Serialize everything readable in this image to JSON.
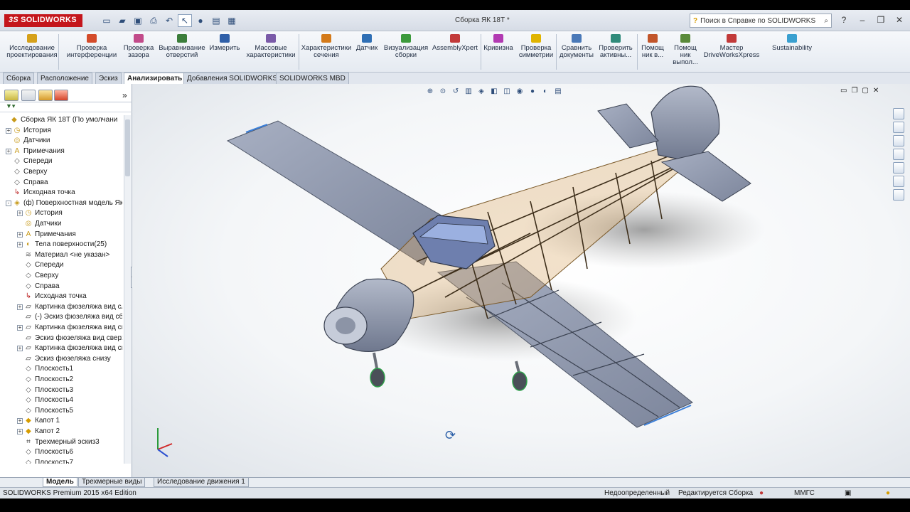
{
  "app": {
    "logo_text": "SOLIDWORKS",
    "logo_prefix": "3S",
    "document_title": "Сборка ЯК 18Т *"
  },
  "help_search": {
    "placeholder": "Поиск в Справке по SOLIDWORKS"
  },
  "ribbon": {
    "items": [
      {
        "label1": "Исследование",
        "label2": "проектирования",
        "icon": "study-icon",
        "color": "#d6a11a"
      },
      {
        "label1": "Проверка",
        "label2": "интерференции",
        "icon": "interference-icon",
        "color": "#d44b2a"
      },
      {
        "label1": "Проверка",
        "label2": "зазора",
        "icon": "clearance-icon",
        "color": "#c24b8a"
      },
      {
        "label1": "Выравнивание",
        "label2": "отверстий",
        "icon": "hole-align-icon",
        "color": "#3b7d3b"
      },
      {
        "label1": "Измерить",
        "label2": "",
        "icon": "measure-icon",
        "color": "#2f5fa8"
      },
      {
        "label1": "Массовые",
        "label2": "характеристики",
        "icon": "mass-props-icon",
        "color": "#7a5aa8"
      },
      {
        "label1": "Характеристики",
        "label2": "сечения",
        "icon": "section-props-icon",
        "color": "#d47a1a"
      },
      {
        "label1": "Датчик",
        "label2": "",
        "icon": "sensor-icon",
        "color": "#2f6fb5"
      },
      {
        "label1": "Визуализация",
        "label2": "сборки",
        "icon": "visualize-icon",
        "color": "#3c9a3c"
      },
      {
        "label1": "AssemblyXpert",
        "label2": "",
        "icon": "assemblyxpert-icon",
        "color": "#c23a3a"
      },
      {
        "label1": "Кривизна",
        "label2": "",
        "icon": "curvature-icon",
        "color": "#b23ab2"
      },
      {
        "label1": "Проверка",
        "label2": "симметрии",
        "icon": "symmetry-icon",
        "color": "#e0b400"
      },
      {
        "label1": "Сравнить",
        "label2": "документы",
        "icon": "compare-icon",
        "color": "#4a79b8"
      },
      {
        "label1": "Проверить",
        "label2": "активны...",
        "icon": "check-active-icon",
        "color": "#2f8a7a"
      },
      {
        "label1": "Помощ",
        "label2": "ник в...",
        "icon": "helper1-icon",
        "color": "#c2552a"
      },
      {
        "label1": "Помощ",
        "label2": "ник",
        "label3": "выпол...",
        "icon": "helper2-icon",
        "color": "#5a8a3a"
      },
      {
        "label1": "Мастер",
        "label2": "DriveWorksXpress",
        "icon": "driveworks-icon",
        "color": "#c23a3a"
      },
      {
        "label1": "Sustainability",
        "label2": "",
        "icon": "sustainability-icon",
        "color": "#3aa0d0"
      }
    ]
  },
  "tabs": [
    "Сборка",
    "Расположение",
    "Эскиз",
    "Анализировать",
    "Добавления SOLIDWORKS",
    "SOLIDWORKS MBD"
  ],
  "feature_tree": [
    {
      "label": "Сборка ЯК 18Т  (По умолчани",
      "level": 0,
      "exp": "",
      "icon": "assembly-icon"
    },
    {
      "label": "История",
      "level": 1,
      "exp": "+",
      "icon": "history-icon"
    },
    {
      "label": "Датчики",
      "level": 1,
      "exp": "",
      "icon": "sensors-icon"
    },
    {
      "label": "Примечания",
      "level": 1,
      "exp": "+",
      "icon": "annotations-icon"
    },
    {
      "label": "Спереди",
      "level": 1,
      "exp": "",
      "icon": "plane-icon"
    },
    {
      "label": "Сверху",
      "level": 1,
      "exp": "",
      "icon": "plane-icon"
    },
    {
      "label": "Справа",
      "level": 1,
      "exp": "",
      "icon": "plane-icon"
    },
    {
      "label": "Исходная точка",
      "level": 1,
      "exp": "",
      "icon": "origin-icon"
    },
    {
      "label": "(ф) Поверхностная модель Як-",
      "level": 1,
      "exp": "-",
      "icon": "part-icon"
    },
    {
      "label": "История",
      "level": 2,
      "exp": "+",
      "icon": "history-icon"
    },
    {
      "label": "Датчики",
      "level": 2,
      "exp": "",
      "icon": "sensors-icon"
    },
    {
      "label": "Примечания",
      "level": 2,
      "exp": "+",
      "icon": "annotations-icon"
    },
    {
      "label": "Тела поверхности(25)",
      "level": 2,
      "exp": "+",
      "icon": "surface-bodies-icon"
    },
    {
      "label": "Материал <не указан>",
      "level": 2,
      "exp": "",
      "icon": "material-icon"
    },
    {
      "label": "Спереди",
      "level": 2,
      "exp": "",
      "icon": "plane-icon"
    },
    {
      "label": "Сверху",
      "level": 2,
      "exp": "",
      "icon": "plane-icon"
    },
    {
      "label": "Справа",
      "level": 2,
      "exp": "",
      "icon": "plane-icon"
    },
    {
      "label": "Исходная точка",
      "level": 2,
      "exp": "",
      "icon": "origin-icon"
    },
    {
      "label": "Картинка фюзеляжа вид сл",
      "level": 2,
      "exp": "+",
      "icon": "sketch-icon"
    },
    {
      "label": "(-) Эскиз фюзеляжа вид сбо",
      "level": 2,
      "exp": "",
      "icon": "sketch-icon"
    },
    {
      "label": "Картинка фюзеляжа вид св",
      "level": 2,
      "exp": "+",
      "icon": "sketch-icon"
    },
    {
      "label": "Эскиз фюзеляжа вид сверх",
      "level": 2,
      "exp": "",
      "icon": "sketch-icon"
    },
    {
      "label": "Картинка фюзеляжа вид сн",
      "level": 2,
      "exp": "+",
      "icon": "sketch-icon"
    },
    {
      "label": "Эскиз фюзеляжа снизу",
      "level": 2,
      "exp": "",
      "icon": "sketch-icon"
    },
    {
      "label": "Плоскость1",
      "level": 2,
      "exp": "",
      "icon": "plane-icon"
    },
    {
      "label": "Плоскость2",
      "level": 2,
      "exp": "",
      "icon": "plane-icon"
    },
    {
      "label": "Плоскость3",
      "level": 2,
      "exp": "",
      "icon": "plane-icon"
    },
    {
      "label": "Плоскость4",
      "level": 2,
      "exp": "",
      "icon": "plane-icon"
    },
    {
      "label": "Плоскость5",
      "level": 2,
      "exp": "",
      "icon": "plane-icon"
    },
    {
      "label": "Капот 1",
      "level": 2,
      "exp": "+",
      "icon": "feature-icon"
    },
    {
      "label": "Капот 2",
      "level": 2,
      "exp": "+",
      "icon": "feature-icon"
    },
    {
      "label": "Трехмерный эскиз3",
      "level": 2,
      "exp": "",
      "icon": "3d-sketch-icon"
    },
    {
      "label": "Плоскость6",
      "level": 2,
      "exp": "",
      "icon": "plane-icon"
    },
    {
      "label": "Плоскость7",
      "level": 2,
      "exp": "",
      "icon": "plane-icon"
    }
  ],
  "bottom_tabs": [
    "Модель",
    "Трехмерные виды",
    "Исследование движения 1"
  ],
  "status": {
    "edition": "SOLIDWORKS Premium 2015 x64 Edition",
    "state": "Недоопределенный",
    "editing": "Редактируется Сборка",
    "units": "ММГС"
  },
  "colors": {
    "accent": "#c4161c",
    "airframe_skin": "#8e97ad",
    "frame_wood": "#d9a867",
    "background": "#f4f6f8"
  }
}
